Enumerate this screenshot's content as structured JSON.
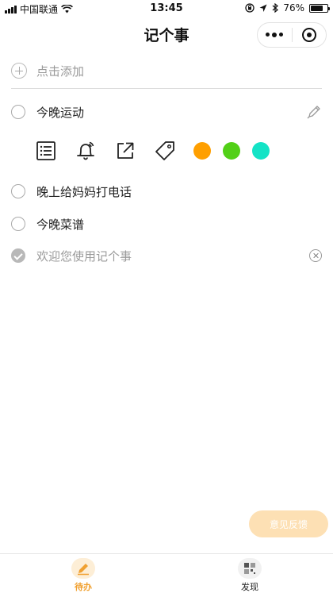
{
  "status_bar": {
    "carrier": "中国联通",
    "time": "13:45",
    "battery": "76%",
    "battery_level": 0.76,
    "icons": [
      "signal-icon",
      "wifi-icon",
      "lock-rotation-icon",
      "location-icon",
      "bluetooth-icon",
      "battery-icon"
    ]
  },
  "nav": {
    "title": "记个事",
    "menu_icon": "more-dots-icon",
    "close_icon": "target-icon"
  },
  "add": {
    "label": "点击添加",
    "icon": "add-circle-icon"
  },
  "todos": [
    {
      "text": "今晚运动",
      "done": false,
      "trailing_icon": "edit-pencil-icon"
    },
    {
      "text": "晚上给妈妈打电话",
      "done": false
    },
    {
      "text": "今晚菜谱",
      "done": false
    },
    {
      "text": "欢迎您使用记个事",
      "done": true,
      "trailing_icon": "delete-x-icon"
    }
  ],
  "tools": {
    "icons": [
      "list-icon",
      "bell-icon",
      "share-icon",
      "tag-icon"
    ],
    "colors": [
      "#ff9f00",
      "#52d017",
      "#14e3c6"
    ]
  },
  "feedback": {
    "label": "意见反馈",
    "color": "#fde0b4"
  },
  "tabs": [
    {
      "label": "待办",
      "icon": "pencil-icon",
      "active": true
    },
    {
      "label": "发现",
      "icon": "discover-grid-icon",
      "active": false
    }
  ],
  "colors": {
    "accent": "#f0a030"
  }
}
